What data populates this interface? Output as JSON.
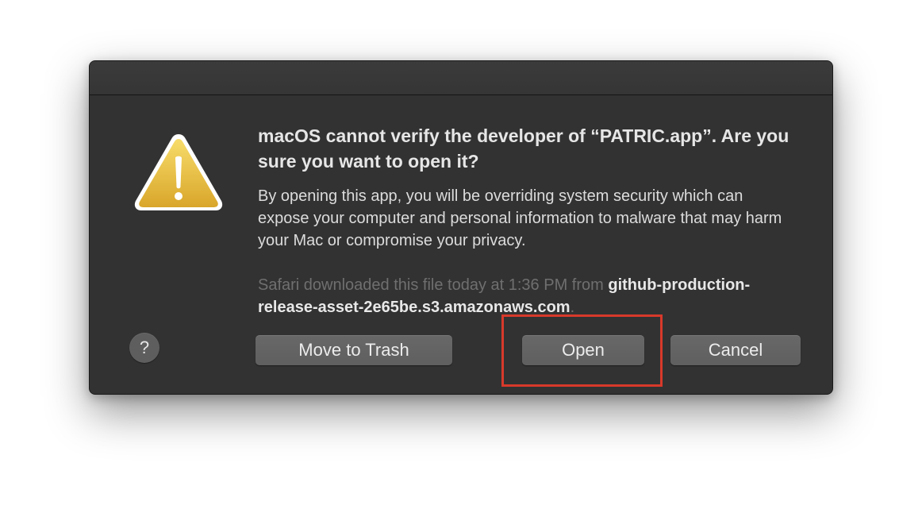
{
  "dialog": {
    "title": "macOS cannot verify the developer of “PATRIC.app”. Are you sure you want to open it?",
    "body": "By opening this app, you will be overriding system security which can expose your computer and personal information to malware that may harm your Mac or compromise your privacy.",
    "source_prefix": "Safari downloaded this file today at 1:36 PM from ",
    "source_host": "github-production-release-asset-2e65be.s3.amazonaws.com",
    "source_suffix": ".",
    "icon": "warning-triangle-icon"
  },
  "buttons": {
    "help_label": "?",
    "trash_label": "Move to Trash",
    "open_label": "Open",
    "cancel_label": "Cancel"
  },
  "colors": {
    "dialog_background": "#323232",
    "button_background": "#636363",
    "warning_yellow": "#f2c83a",
    "highlight_red": "#d8392b"
  }
}
